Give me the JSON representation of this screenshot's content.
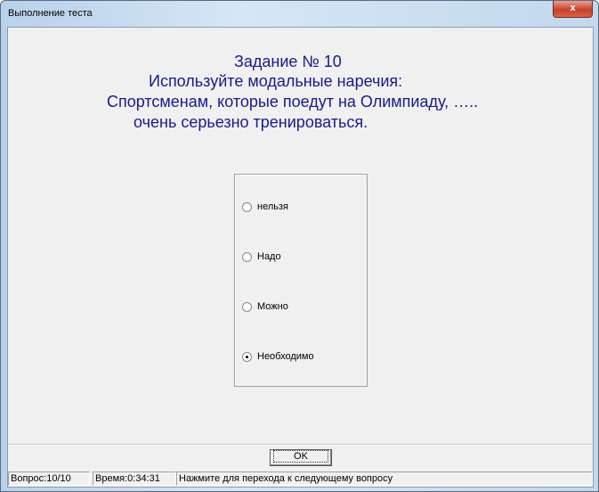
{
  "window": {
    "title": "Выполнение теста",
    "close_label": "x"
  },
  "question": {
    "line1": "Задание № 10",
    "line2": "Используйте модальные наречия:",
    "line3": "Спортсменам, которые поедут на Олимпиаду, …..",
    "line4": "очень серьезно тренироваться."
  },
  "options": [
    {
      "label": "нельзя",
      "selected": false
    },
    {
      "label": "Надо",
      "selected": false
    },
    {
      "label": "Можно",
      "selected": false
    },
    {
      "label": "Необходимо",
      "selected": true
    }
  ],
  "ok_label": "OK",
  "status": {
    "question": "Вопрос:10/10",
    "time": "Время:0:34:31",
    "hint": "Нажмите для перехода к следующему вопросу"
  }
}
